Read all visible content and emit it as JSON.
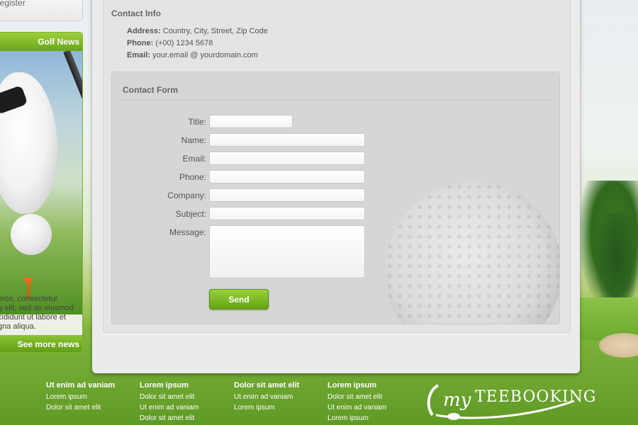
{
  "sidebar": {
    "register_label": "Register",
    "news": {
      "title": "Golf News",
      "text_lines": [
        "eros, consectetur",
        "g elit, sed do eiusmod",
        "cididunt ut labore et",
        "gna aliqua."
      ],
      "see_more_label": "See more news"
    }
  },
  "contact_info": {
    "heading": "Contact Info",
    "address_label": "Address:",
    "address_value": " Country, City, Street, Zip Code",
    "phone_label": "Phone:",
    "phone_value": " (+00) 1234 5678",
    "email_label": "Email:",
    "email_value": " your.email @ yourdomain.com"
  },
  "contact_form": {
    "heading": "Contact Form",
    "fields": {
      "title": {
        "label": "Title:",
        "value": ""
      },
      "name": {
        "label": "Name:",
        "value": ""
      },
      "email": {
        "label": "Email:",
        "value": ""
      },
      "phone": {
        "label": "Phone:",
        "value": ""
      },
      "company": {
        "label": "Company:",
        "value": ""
      },
      "subject": {
        "label": "Subject:",
        "value": ""
      },
      "message": {
        "label": "Message:",
        "value": ""
      }
    },
    "send_label": "Send"
  },
  "footer": {
    "columns": [
      {
        "heading": "",
        "links": [
          "",
          "",
          "",
          ""
        ],
        "partial": true
      },
      {
        "heading": "Ut enim ad vaniam",
        "links": [
          "Lorem ipsum",
          "Dolor sit amet elit"
        ]
      },
      {
        "heading": "Lorem ipsum",
        "links": [
          "Dolor sit amet elit",
          "Ut enim ad vaniam",
          "Dolor sit amet elit"
        ]
      },
      {
        "heading": "Dolor sit amet elit",
        "links": [
          "Ut enim ad vaniam",
          "Lorem ipsum"
        ]
      },
      {
        "heading": "Lorem ipsum",
        "links": [
          "Dolor sit amet elit",
          "Ut enim ad vaniam",
          "Lorem ipsum"
        ]
      }
    ]
  },
  "logo": {
    "prefix": "my",
    "name": "TEEBOOKING"
  },
  "colors": {
    "accent_green": "#7db32a",
    "button_green": "#6aa51a",
    "panel_bg": "#e4e4e4"
  }
}
